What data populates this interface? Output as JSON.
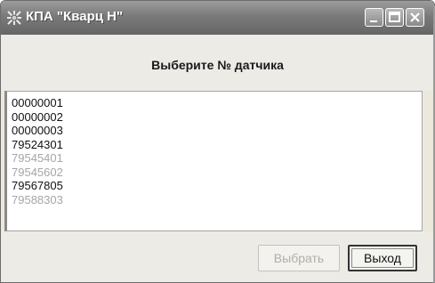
{
  "window": {
    "title": "КПА \"Кварц Н\""
  },
  "header": {
    "title": "Выберите № датчика"
  },
  "sensor_list": {
    "items": [
      {
        "label": "00000001",
        "enabled": true
      },
      {
        "label": "00000002",
        "enabled": true
      },
      {
        "label": "00000003",
        "enabled": true
      },
      {
        "label": "79524301",
        "enabled": true
      },
      {
        "label": "79545401",
        "enabled": false
      },
      {
        "label": "79545602",
        "enabled": false
      },
      {
        "label": "79567805",
        "enabled": true
      },
      {
        "label": "79588303",
        "enabled": false
      }
    ]
  },
  "footer": {
    "select_label": "Выбрать",
    "exit_label": "Выход"
  },
  "icons": {
    "app": "app-icon",
    "minimize": "minimize-icon",
    "maximize": "maximize-icon",
    "close": "close-icon"
  },
  "colors": {
    "titlebar": "#7a7a7a",
    "disabled_text": "#a6a6a6",
    "window_bg": "#ecebe6"
  }
}
